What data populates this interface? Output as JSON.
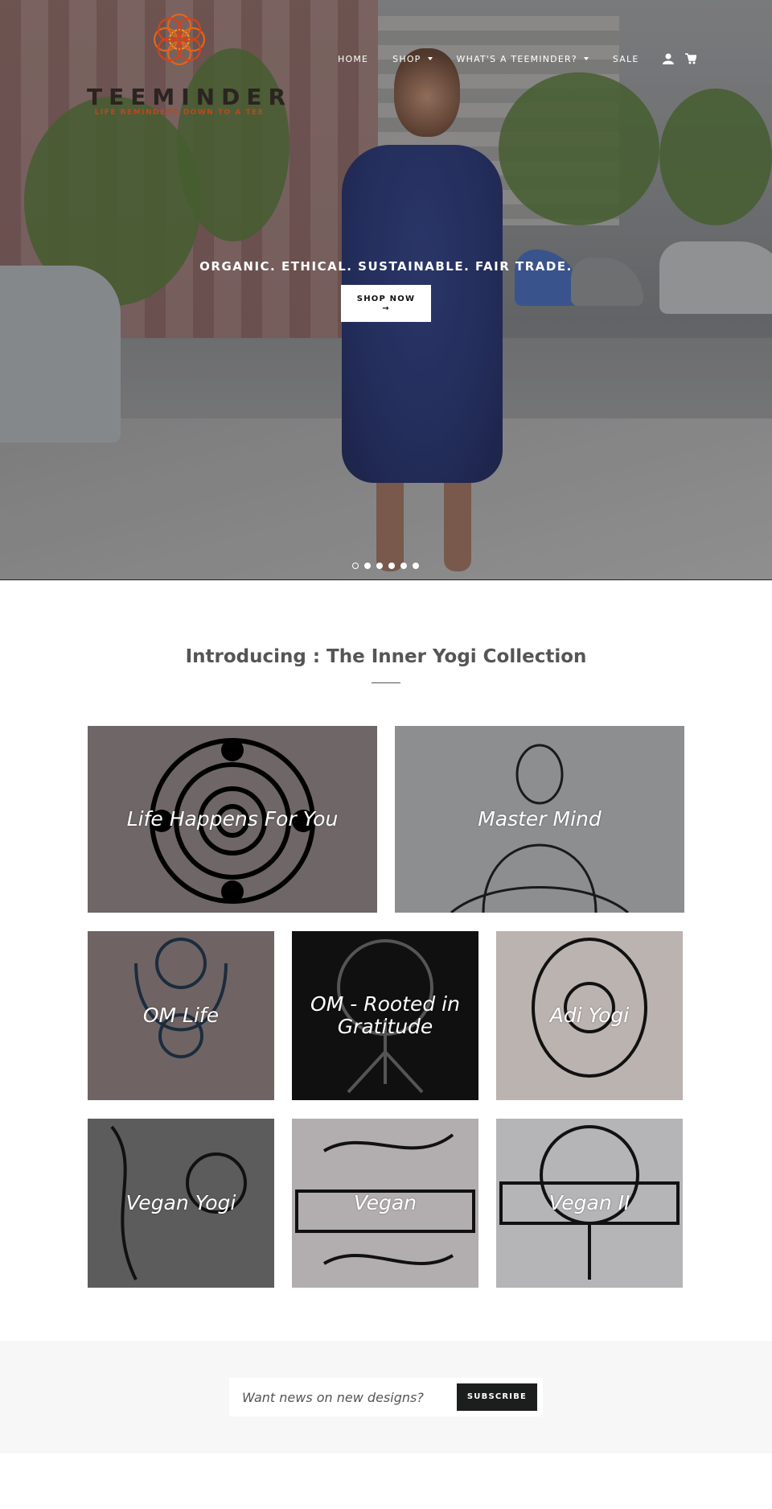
{
  "brand": {
    "name": "TEEMINDER",
    "tagline": "LIFE REMINDERS DOWN TO A TEE",
    "accent": "#c2451c"
  },
  "nav": {
    "items": [
      {
        "label": "HOME",
        "has_dropdown": false
      },
      {
        "label": "SHOP",
        "has_dropdown": true
      },
      {
        "label": "WHAT'S A TEEMINDER?",
        "has_dropdown": true
      },
      {
        "label": "SALE",
        "has_dropdown": false
      }
    ],
    "icons": [
      "account-icon",
      "cart-icon"
    ]
  },
  "hero": {
    "tagline": "ORGANIC. ETHICAL. SUSTAINABLE. FAIR TRADE.",
    "button_label": "SHOP NOW",
    "button_arrow": "→",
    "slides": 6,
    "active_slide": 1
  },
  "collection": {
    "title": "Introducing : The Inner Yogi Collection",
    "items": [
      {
        "label": "Life Happens For You",
        "bg": "#6e6667"
      },
      {
        "label": "Master Mind",
        "bg": "#8d8e90"
      },
      {
        "label": "OM Life",
        "bg": "#6f6463"
      },
      {
        "label": "OM - Rooted in Gratitude",
        "bg": "#101010"
      },
      {
        "label": "Adi Yogi",
        "bg": "#bab3b0"
      },
      {
        "label": "Vegan Yogi",
        "bg": "#5c5c5c"
      },
      {
        "label": "Vegan",
        "bg": "#b2aeaf"
      },
      {
        "label": "Vegan II",
        "bg": "#b5b5b7"
      }
    ]
  },
  "newsletter": {
    "placeholder": "Want news on new designs?",
    "button_label": "SUBSCRIBE"
  }
}
